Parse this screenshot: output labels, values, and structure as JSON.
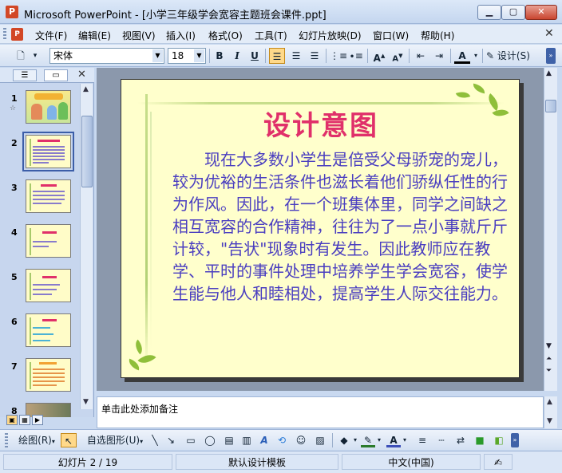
{
  "window": {
    "title": "Microsoft PowerPoint - [小学三年级学会宽容主题班会课件.ppt]",
    "app_icon": "powerpoint-icon",
    "controls": [
      "minimize-icon",
      "maximize-icon",
      "close-icon"
    ]
  },
  "menu": {
    "items": [
      "文件(F)",
      "编辑(E)",
      "视图(V)",
      "插入(I)",
      "格式(O)",
      "工具(T)",
      "幻灯片放映(D)",
      "窗口(W)",
      "帮助(H)"
    ]
  },
  "toolbar": {
    "font_name": "宋体",
    "font_size": "18",
    "bold": "B",
    "italic": "I",
    "underline": "U",
    "design_label": "设计(S)"
  },
  "slides_panel": {
    "slide_count": 8,
    "selected": 2,
    "numbers": [
      "1",
      "2",
      "3",
      "4",
      "5",
      "6",
      "7",
      "8"
    ]
  },
  "slide": {
    "title": "设计意图",
    "body": "现在大多数小学生是倍受父母骄宠的宠儿，较为优裕的生活条件也滋长着他们骄纵任性的行为作风。因此，在一个班集体里，同学之间缺之相互宽容的合作精神，往往为了一点小事就斤斤计较，\"告状\"现象时有发生。因此教师应在教学、平时的事件处理中培养学生学会宽容，使学生能与他人和睦相处，提高学生人际交往能力。"
  },
  "notes": {
    "placeholder": "单击此处添加备注"
  },
  "drawing_toolbar": {
    "draw_label": "绘图(R)",
    "autoshapes_label": "自选图形(U)"
  },
  "status": {
    "slide_info": "幻灯片 2 / 19",
    "template": "默认设计模板",
    "language": "中文(中国)"
  },
  "colors": {
    "slide_bg": "#ffffcc",
    "title": "#e0306a",
    "body": "#4a3ec0",
    "accent": "#8fbf3a"
  }
}
